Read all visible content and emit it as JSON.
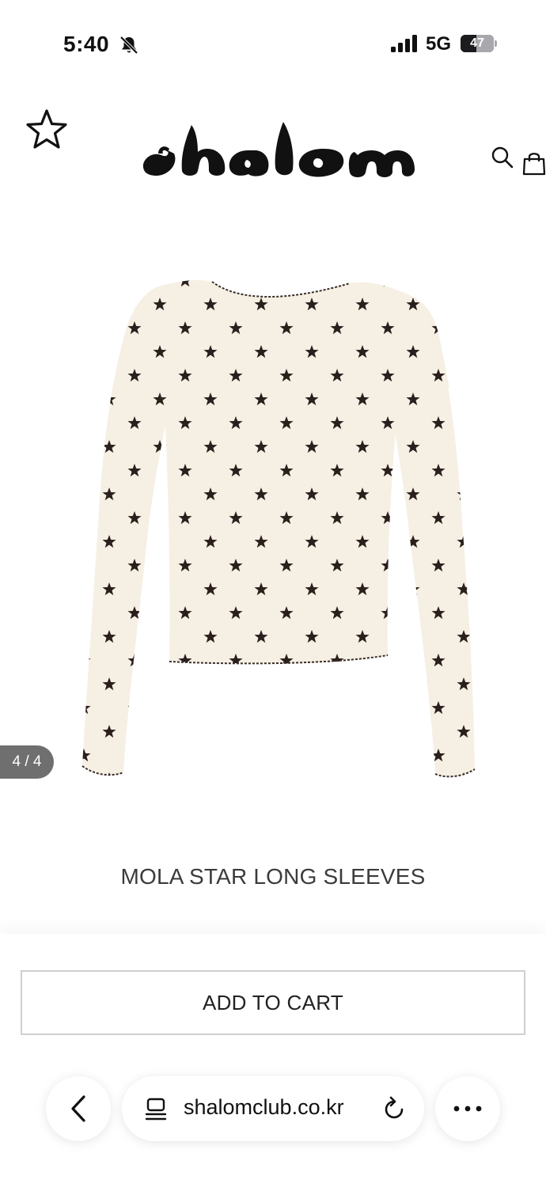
{
  "status_bar": {
    "time": "5:40",
    "network": "5G",
    "battery_percent": "47",
    "battery_level": 0.47,
    "icons": [
      "bell-slash-icon",
      "cellular-signal-icon",
      "battery-icon"
    ]
  },
  "header": {
    "brand": "shalom",
    "icons": [
      "star-outline-icon",
      "search-icon",
      "shopping-bag-icon"
    ]
  },
  "product": {
    "image_counter": "4 / 4",
    "title": "MOLA STAR LONG SLEEVES",
    "colors": {
      "fabric": "#f5f0e3",
      "star_print": "#2a1f1d"
    }
  },
  "actions": {
    "add_to_cart_label": "ADD TO CART"
  },
  "browser": {
    "url": "shalomclub.co.kr",
    "icons": [
      "chevron-left-icon",
      "reader-mode-icon",
      "reload-icon",
      "more-horizontal-icon"
    ]
  }
}
